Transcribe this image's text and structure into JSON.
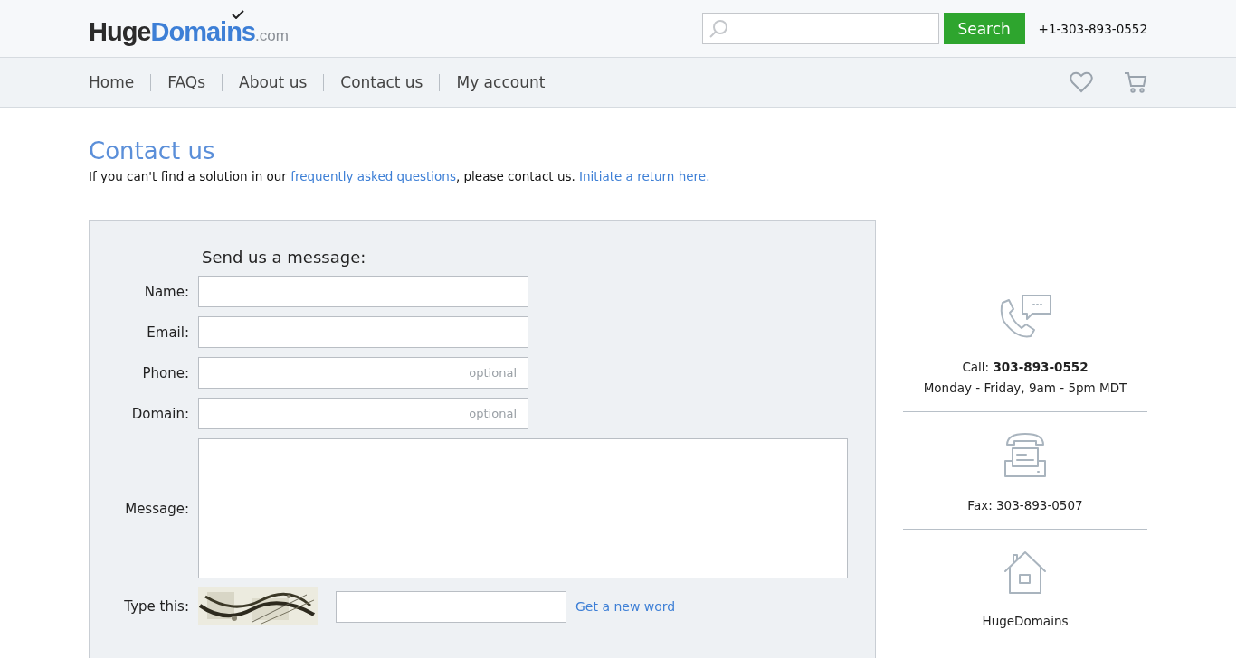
{
  "header": {
    "logo": {
      "main": "Huge",
      "accent": "Domains",
      "suffix": ".com"
    },
    "search_button": "Search",
    "phone": "+1-303-893-0552"
  },
  "nav": {
    "items": [
      {
        "label": "Home"
      },
      {
        "label": "FAQs"
      },
      {
        "label": "About us"
      },
      {
        "label": "Contact us"
      },
      {
        "label": "My account"
      }
    ]
  },
  "page": {
    "title": "Contact us",
    "intro": {
      "before": "If you can't find a solution in our",
      "faq_link": "frequently asked questions",
      "middle": ", please contact us.",
      "return_link": "Initiate a return here."
    }
  },
  "form": {
    "heading": "Send us a message:",
    "fields": [
      {
        "kind": "input",
        "label": "Name:"
      },
      {
        "kind": "input",
        "label": "Email:"
      },
      {
        "kind": "input",
        "label": "Phone:",
        "placeholder": "optional"
      },
      {
        "kind": "input",
        "label": "Domain:",
        "placeholder": "optional"
      },
      {
        "kind": "textarea",
        "label": "Message:"
      }
    ],
    "captcha": {
      "label": "Type this:",
      "new_word_link": "Get a new word"
    }
  },
  "contact_info": [
    {
      "kind": "call",
      "lines": [
        "Call: **303-893-0552**",
        "Monday - Friday, 9am - 5pm MDT"
      ]
    },
    {
      "kind": "fax",
      "lines": [
        "Fax: 303-893-0507"
      ]
    },
    {
      "kind": "address",
      "lines": [
        "HugeDomains"
      ]
    }
  ]
}
